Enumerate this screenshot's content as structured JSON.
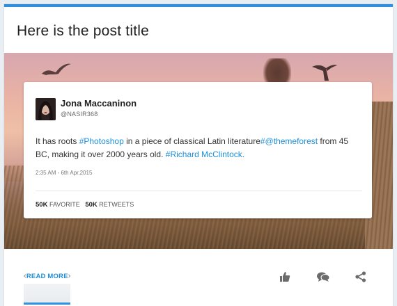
{
  "post": {
    "title": "Here is the post title",
    "accent_color": "#2f8fe0",
    "link_color": "#1d8fd8"
  },
  "tweet": {
    "author_name": "Jona Maccaninon",
    "author_handle": "@NASIR368",
    "text_parts": {
      "t1": "It has roots ",
      "l1": "#Photoshop",
      "t2": " in a piece of classical Latin literature",
      "l2": "#@themeforest",
      "t3": " from 45 BC, making it over 2000 years old. ",
      "l3": "#Richard McClintock."
    },
    "date": "2:35 AM - 6th Apr,2015",
    "favorite_count": "50K",
    "favorite_label": "FAVORITE",
    "retweet_count": "50K",
    "retweet_label": "RETWEETS"
  },
  "footer": {
    "read_more_label": "READ MORE",
    "chevron_left": "‹",
    "chevron_right": "›",
    "actions": [
      "thumbs-up-icon",
      "comments-icon",
      "share-icon"
    ]
  }
}
